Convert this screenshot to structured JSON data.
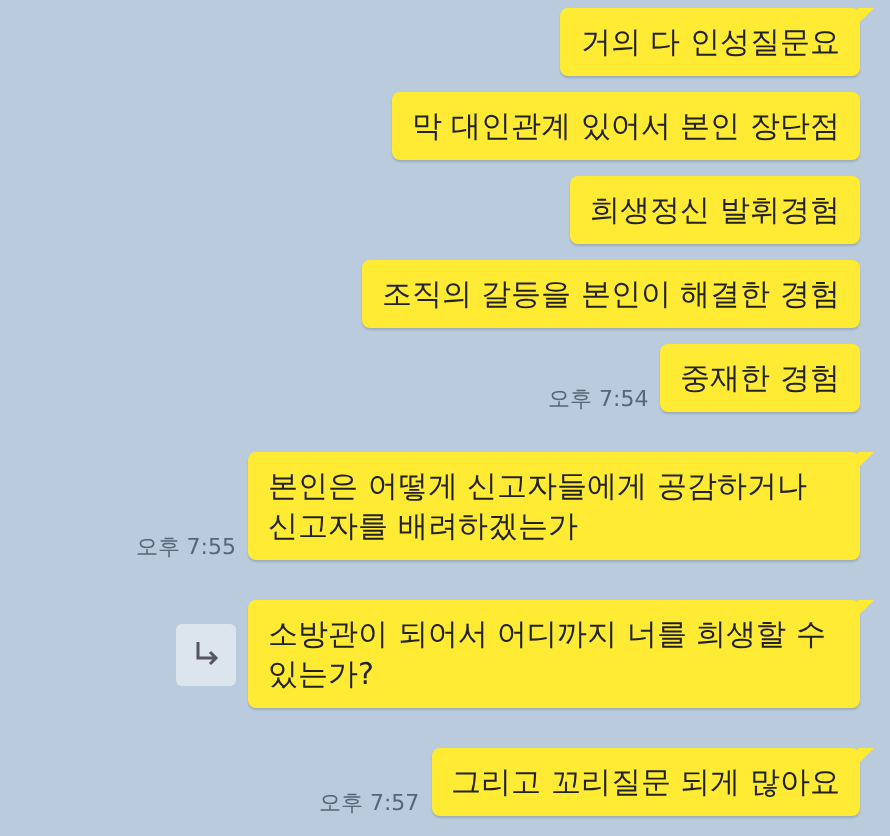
{
  "groups": [
    {
      "time": "오후 7:54",
      "messages": [
        {
          "text": "거의 다 인성질문요",
          "share_button": false
        },
        {
          "text": "막 대인관계 있어서 본인 장단점",
          "share_button": false
        },
        {
          "text": "희생정신 발휘경험",
          "share_button": false
        },
        {
          "text": "조직의 갈등을 본인이 해결한 경험",
          "share_button": false
        },
        {
          "text": "중재한 경험",
          "share_button": false
        }
      ]
    },
    {
      "time": "오후 7:55",
      "messages": [
        {
          "text": "본인은 어떻게 신고자들에게 공감하거나 신고자를 배려하겠는가",
          "share_button": false
        }
      ]
    },
    {
      "messages": [
        {
          "text": "소방관이 되어서 어디까지 너를 희생할 수 있는가?",
          "share_button": true
        }
      ]
    },
    {
      "time": "오후 7:57",
      "messages": [
        {
          "text": "그리고 꼬리질문 되게 많아요",
          "share_button": false
        }
      ]
    }
  ]
}
